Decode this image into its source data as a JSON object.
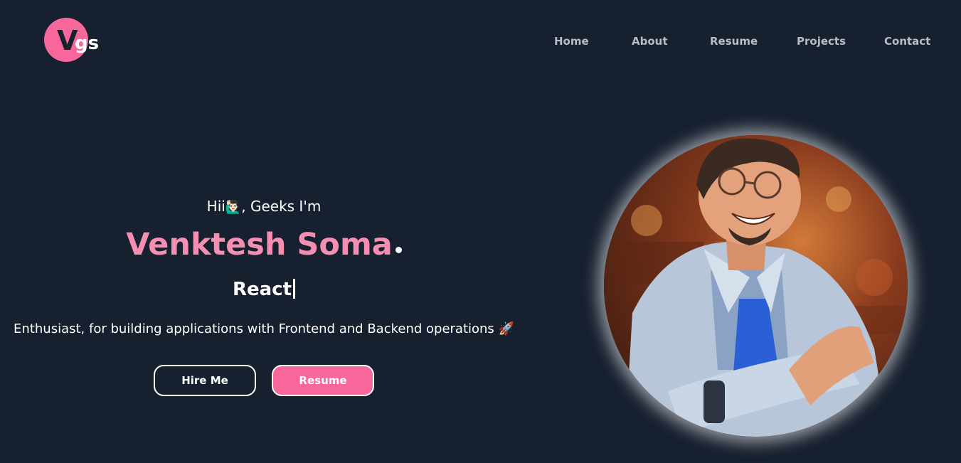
{
  "logo": {
    "letter_main": "V",
    "letter_sub": "gs"
  },
  "nav": {
    "items": [
      {
        "label": "Home"
      },
      {
        "label": "About"
      },
      {
        "label": "Resume"
      },
      {
        "label": "Projects"
      },
      {
        "label": "Contact"
      }
    ]
  },
  "hero": {
    "greeting_prefix": "Hii",
    "greeting_emoji": "🙋🏻‍♂️",
    "greeting_suffix": ", Geeks I'm",
    "name": "Venktesh Soma",
    "typed_role": "React",
    "tagline": "Enthusiast, for building applications with Frontend and Backend operations 🚀"
  },
  "buttons": {
    "hire_label": "Hire Me",
    "resume_label": "Resume"
  },
  "colors": {
    "background": "#17202f",
    "accent": "#f7679b",
    "name": "#f48fb1",
    "nav_text": "#b8bcc4"
  },
  "avatar": {
    "icon": "profile-illustration"
  }
}
